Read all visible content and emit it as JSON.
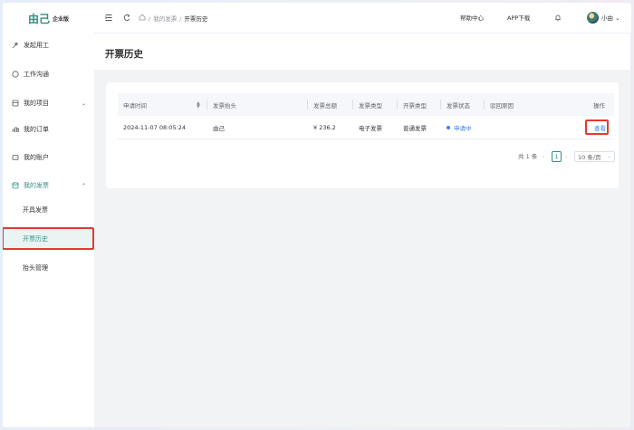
{
  "brand": {
    "name": "由己",
    "edition": "企业版"
  },
  "sidebar": {
    "items": [
      {
        "label": "发起用工",
        "icon": "magic-wand-icon"
      },
      {
        "label": "工作沟通",
        "icon": "chat-icon"
      },
      {
        "label": "我的项目",
        "icon": "project-icon"
      },
      {
        "label": "我的订单",
        "icon": "order-icon"
      },
      {
        "label": "我的账户",
        "icon": "wallet-icon"
      },
      {
        "label": "我的发票",
        "icon": "invoice-icon"
      }
    ],
    "sub_items": [
      {
        "label": "开具发票"
      },
      {
        "label": "开票历史"
      },
      {
        "label": "抬头管理"
      }
    ],
    "expand_chevron": "⌄",
    "collapse_chevron": "⌃"
  },
  "header": {
    "breadcrumb": [
      "我的发票",
      "开票历史"
    ],
    "breadcrumb_sep": "/",
    "help": "帮助中心",
    "app_download": "APP下载",
    "user_name": "小由",
    "user_chevron": "⌄"
  },
  "page": {
    "title": "开票历史"
  },
  "table": {
    "columns": [
      "申请时间",
      "发票抬头",
      "发票总额",
      "发票类型",
      "开票类型",
      "发票状态",
      "驳回原因",
      "操作"
    ],
    "rows": [
      {
        "time": "2024-11-07 08:05:24",
        "title": "由己",
        "amount": "¥ 236.2",
        "invoice_type": "电子发票",
        "issue_type": "普通发票",
        "status": "申请中",
        "reject_reason": "",
        "action": "查看"
      }
    ]
  },
  "pagination": {
    "total": "共 1 条",
    "current_page": "1",
    "page_size": "10 条/页",
    "prev": "‹",
    "next": "›"
  },
  "colors": {
    "accent": "#2f8f83",
    "link": "#3d7df0",
    "highlight": "#e53935"
  }
}
